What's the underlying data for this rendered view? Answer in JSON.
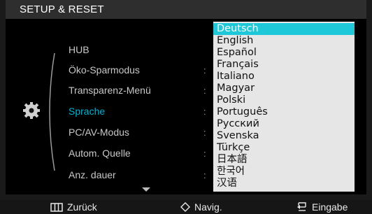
{
  "header": {
    "title": "SETUP & RESET"
  },
  "menu": {
    "items": [
      {
        "label": "HUB"
      },
      {
        "label": "Öko-Sparmodus"
      },
      {
        "label": "Transparenz-Menü"
      },
      {
        "label": "Sprache"
      },
      {
        "label": "PC/AV-Modus"
      },
      {
        "label": "Autom. Quelle"
      },
      {
        "label": "Anz. dauer"
      }
    ],
    "selected": "Sprache",
    "colon": ":"
  },
  "languages": [
    "Deutsch",
    "English",
    "Español",
    "Français",
    "Italiano",
    "Magyar",
    "Polski",
    "Português",
    "Русский",
    "Svenska",
    "Türkçe",
    "日本語",
    "한국어",
    "汉语"
  ],
  "selected_language": "Deutsch",
  "footer": {
    "back_label": "Zurück",
    "nav_label": "Navig.",
    "enter_label": "Eingabe"
  },
  "colors": {
    "accent": "#00b4d8",
    "highlight": "#1ec8d8",
    "dropdown_bg": "#e6e6e6"
  }
}
